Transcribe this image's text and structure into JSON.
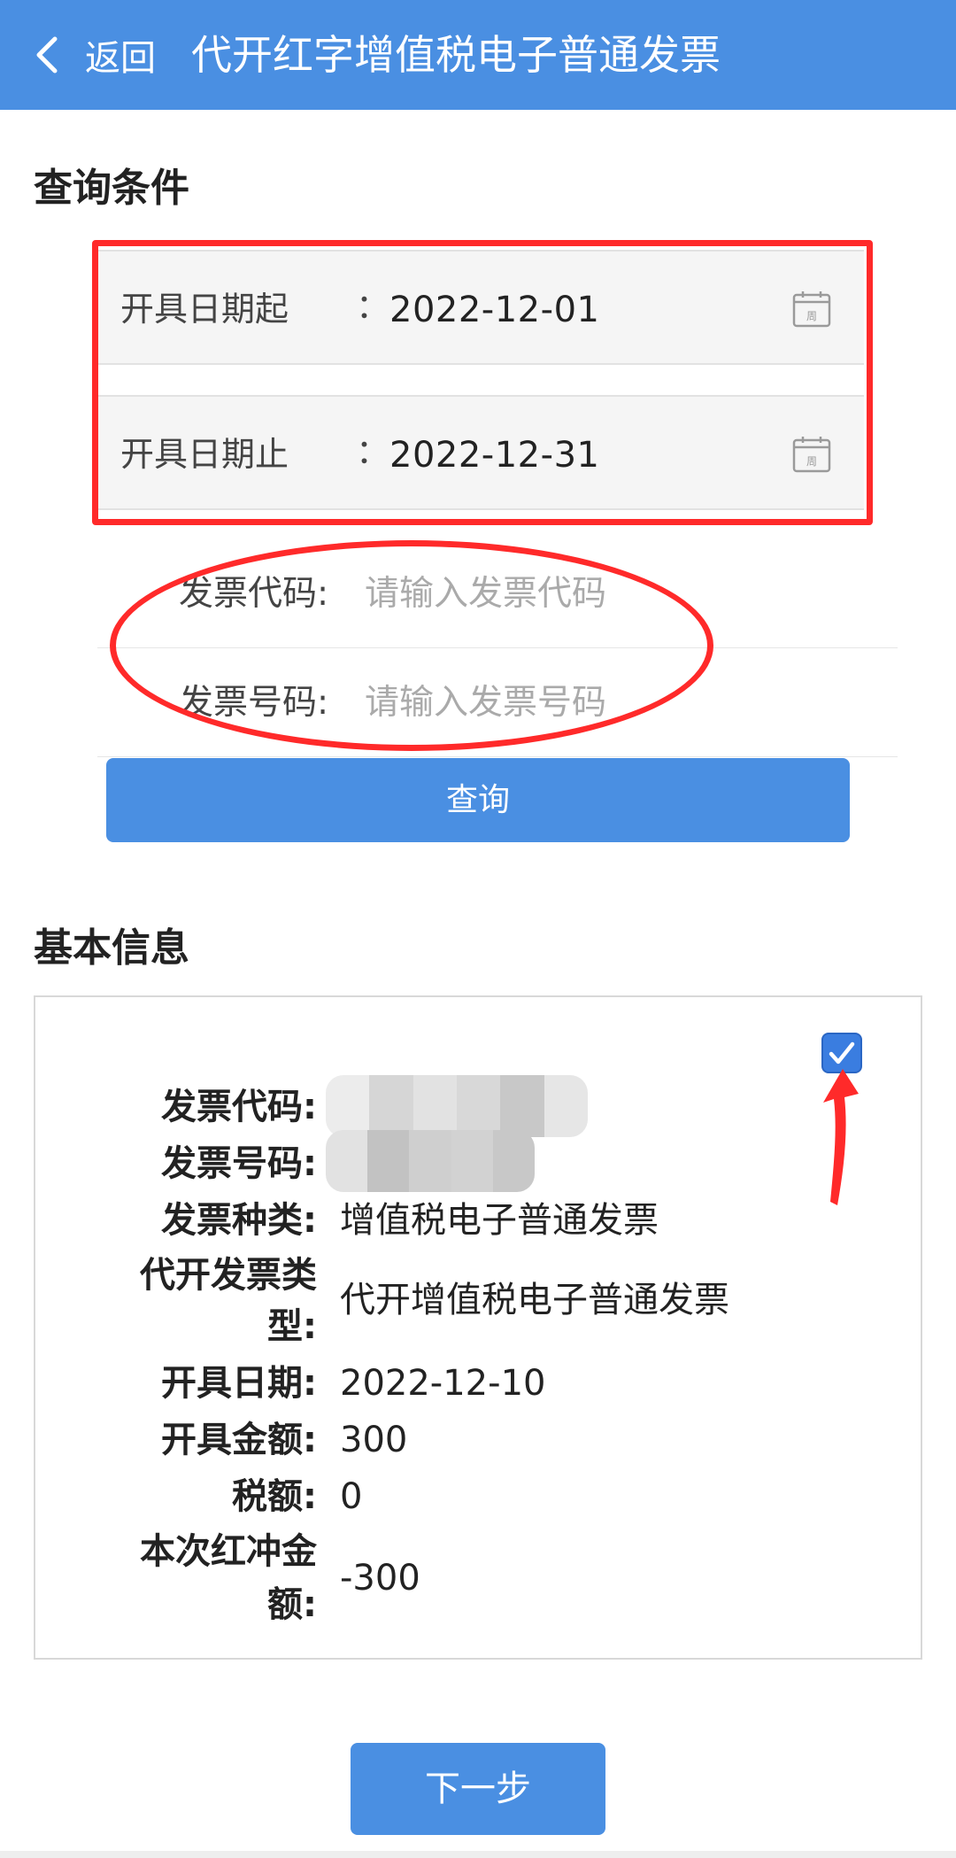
{
  "header": {
    "back_label": "返回",
    "title": "代开红字增值税电子普通发票",
    "color": "#4a8fe2"
  },
  "query_section": {
    "title": "查询条件",
    "start_date": {
      "label": "开具日期起",
      "colon": "：",
      "value": "2022-12-01",
      "icon": "calendar-icon",
      "icon_text": "周"
    },
    "end_date": {
      "label": "开具日期止",
      "colon": "：",
      "value": "2022-12-31",
      "icon": "calendar-icon",
      "icon_text": "周"
    },
    "invoice_code": {
      "label": "发票代码:",
      "placeholder": "请输入发票代码"
    },
    "invoice_number": {
      "label": "发票号码:",
      "placeholder": "请输入发票号码"
    },
    "query_button": "查询"
  },
  "info_section": {
    "title": "基本信息",
    "checked": true,
    "fields": {
      "invoice_code_label": "发票代码:",
      "invoice_number_label": "发票号码:",
      "invoice_type_label": "发票种类:",
      "invoice_type_value": "增值税电子普通发票",
      "issue_type_label_line1": "代开发票类",
      "issue_type_label_line2": "型:",
      "issue_type_value": "代开增值税电子普通发票",
      "issue_date_label": "开具日期:",
      "issue_date_value": "2022-12-10",
      "amount_label": "开具金额:",
      "amount_value": "300",
      "tax_label": "税额:",
      "tax_value": "0",
      "red_amount_label_line1": "本次红冲金",
      "red_amount_label_line2": "额:",
      "red_amount_value": "-300"
    }
  },
  "next_button": "下一步",
  "annotation_color": "#ff2a2a"
}
